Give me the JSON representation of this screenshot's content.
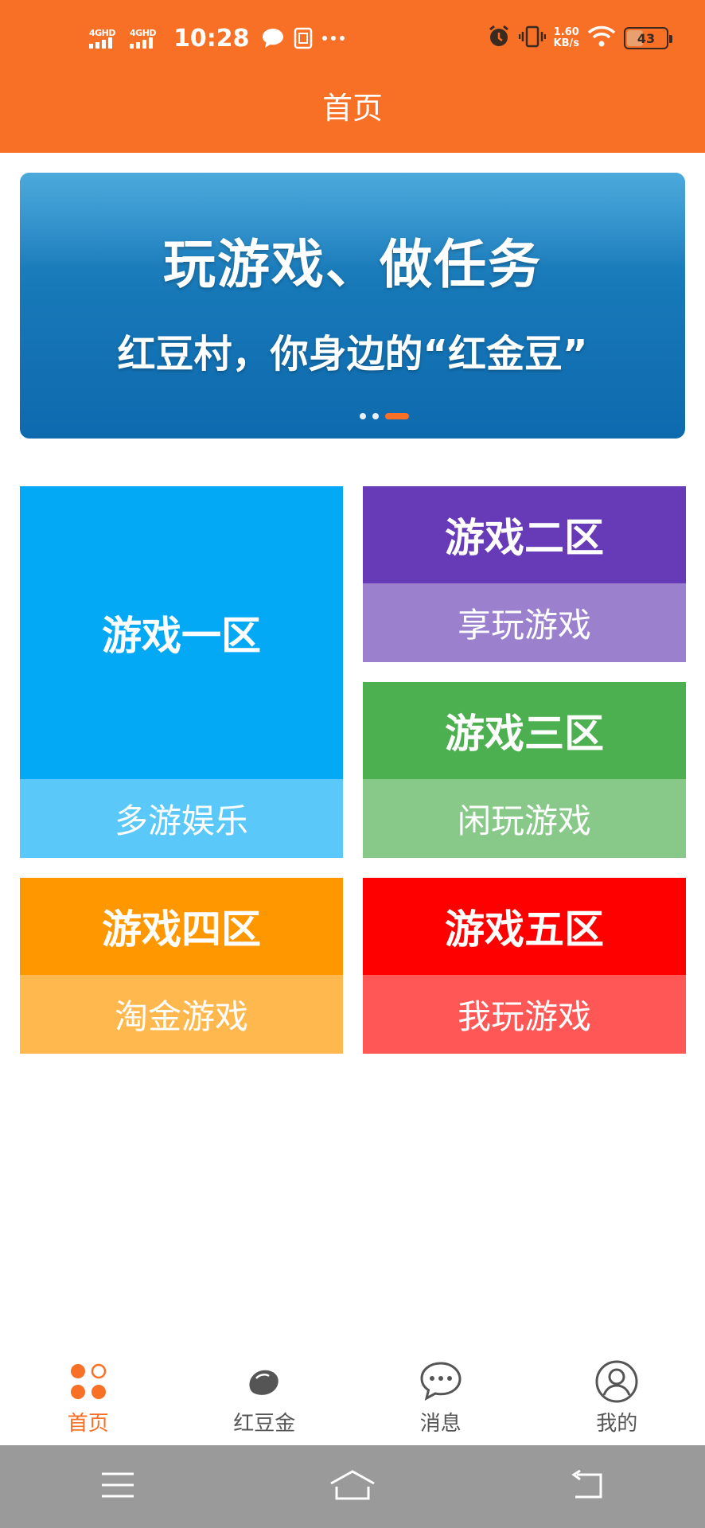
{
  "status_bar": {
    "signal1_label": "4GHD",
    "signal2_label": "4GHD",
    "time": "10:28",
    "speed_value": "1.60",
    "speed_unit": "KB/s",
    "battery_level": "43"
  },
  "header": {
    "title": "首页"
  },
  "banner": {
    "headline": "玩游戏、做任务",
    "subline": "红豆村，你身边的“红金豆”",
    "slide_count": 3,
    "active_slide": 3
  },
  "tiles": [
    {
      "title": "游戏一区",
      "subtitle": "多游娱乐",
      "color": "#03A9F4"
    },
    {
      "title": "游戏二区",
      "subtitle": "享玩游戏",
      "color": "#673AB7"
    },
    {
      "title": "游戏三区",
      "subtitle": "闲玩游戏",
      "color": "#4CAF50"
    },
    {
      "title": "游戏四区",
      "subtitle": "淘金游戏",
      "color": "#FF9800"
    },
    {
      "title": "游戏五区",
      "subtitle": "我玩游戏",
      "color": "#FF0000"
    }
  ],
  "tabbar": {
    "items": [
      {
        "label": "首页",
        "icon": "home-dots-icon",
        "active": true
      },
      {
        "label": "红豆金",
        "icon": "bean-icon",
        "active": false
      },
      {
        "label": "消息",
        "icon": "chat-bubble-icon",
        "active": false
      },
      {
        "label": "我的",
        "icon": "user-circle-icon",
        "active": false
      }
    ]
  },
  "navbar": {
    "icons": [
      "menu-icon",
      "home-icon",
      "back-icon"
    ]
  },
  "colors": {
    "accent": "#F86F26",
    "nav_bg": "#9A9A9A"
  }
}
